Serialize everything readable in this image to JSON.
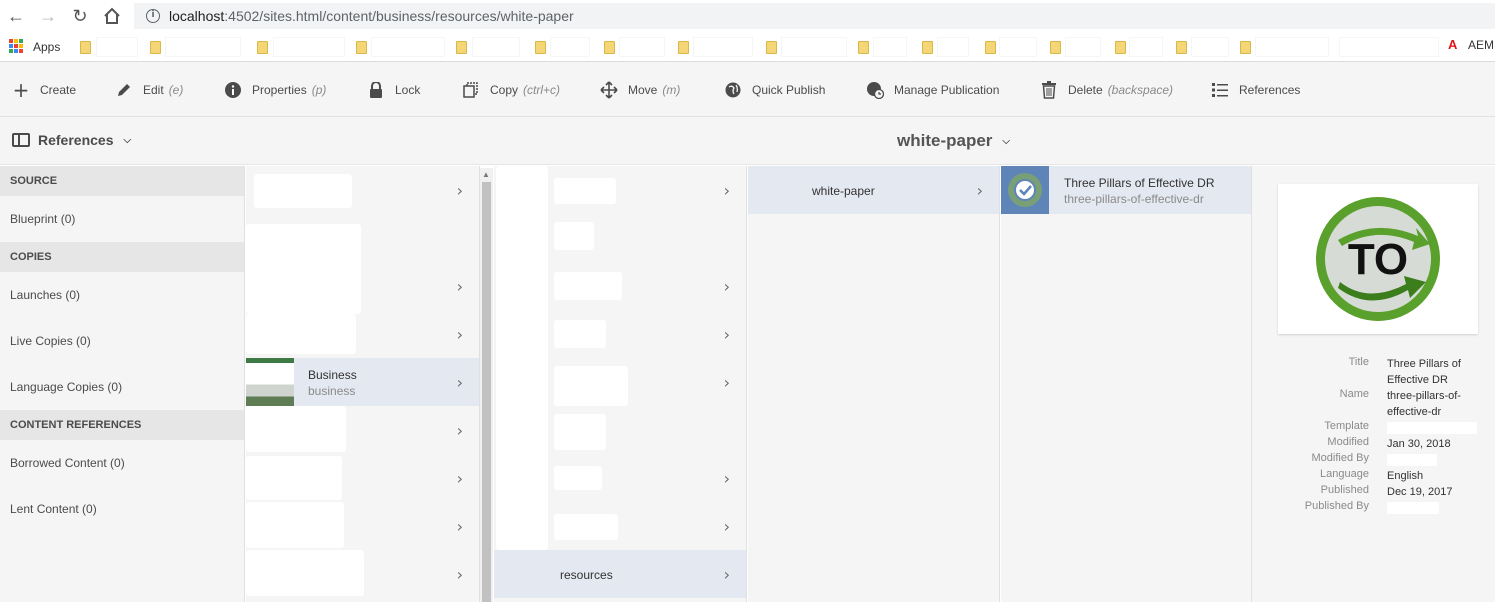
{
  "browser": {
    "url_host": "localhost",
    "url_path": ":4502/sites.html/content/business/resources/white-paper",
    "bookmarks_apps": "Apps",
    "bookmark_aem": "AEM"
  },
  "actions": {
    "create": "Create",
    "edit": "Edit",
    "edit_shortcut": "(e)",
    "properties": "Properties",
    "properties_shortcut": "(p)",
    "lock": "Lock",
    "copy": "Copy",
    "copy_shortcut": "(ctrl+c)",
    "move": "Move",
    "move_shortcut": "(m)",
    "quick_publish": "Quick Publish",
    "manage_publication": "Manage Publication",
    "delete": "Delete",
    "delete_shortcut": "(backspace)",
    "references": "References"
  },
  "subheader": {
    "rail_label": "References",
    "page_title": "white-paper"
  },
  "rail": {
    "source_header": "SOURCE",
    "blueprint": "Blueprint (0)",
    "copies_header": "COPIES",
    "launches": "Launches (0)",
    "live_copies": "Live Copies (0)",
    "language_copies": "Language Copies (0)",
    "content_refs_header": "CONTENT REFERENCES",
    "borrowed": "Borrowed Content (0)",
    "lent": "Lent Content (0)"
  },
  "columns": {
    "business_title": "Business",
    "business_name": "business",
    "resources_title": "resources",
    "white_paper_title": "white-paper",
    "page_title": "Three Pillars of Effective DR",
    "page_name": "three-pillars-of-effective-dr"
  },
  "detail": {
    "thumbnail_text": "TO",
    "title_label": "Title",
    "title_value": "Three Pillars of Effective DR",
    "name_label": "Name",
    "name_value": "three-pillars-of-effective-dr",
    "template_label": "Template",
    "modified_label": "Modified",
    "modified_value": "Jan 30, 2018",
    "modified_by_label": "Modified By",
    "language_label": "Language",
    "language_value": "English",
    "published_label": "Published",
    "published_value": "Dec 19, 2017",
    "published_by_label": "Published By"
  },
  "colors": {
    "selected_row": "#e4e8f1",
    "logo_green": "#5aa02c"
  }
}
